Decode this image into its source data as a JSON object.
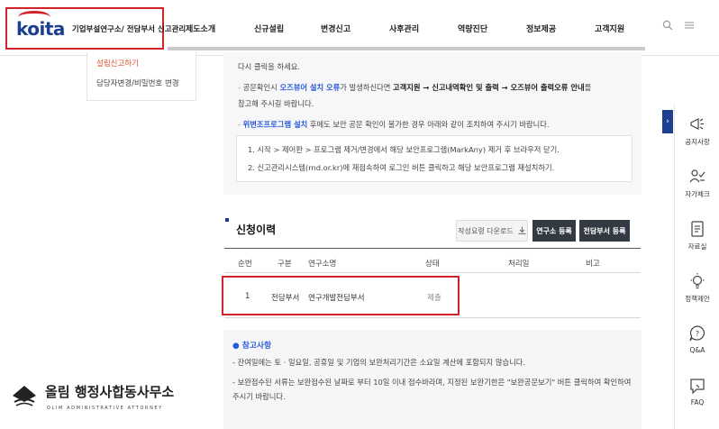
{
  "header": {
    "logo_text": "koita",
    "brand_title": "기업부설연구소/ 전담부서 신고관리",
    "nav": [
      "제도소개",
      "신규설립",
      "변경신고",
      "사후관리",
      "역량진단",
      "정보제공",
      "고객지원"
    ],
    "search_icon": "search-icon",
    "menu_icon": "hamburger-menu-icon"
  },
  "submenu": {
    "items": [
      "설립신고하기",
      "담당자변경/비밀번호 변경"
    ],
    "active_color": "#e0502e"
  },
  "notice": {
    "line1": "다시 클릭을 하세요.",
    "line2_a": "공문확인시 ",
    "line2_b": "오즈뷰어 설치 오류",
    "line2_c": "가 발생하신다면 ",
    "line2_d": "고객지원 → 신고내역확인 및 출력 → 오즈뷰어 출력오류 안내",
    "line2_e": "를",
    "line3": "참고해 주시길 바랍니다.",
    "line4_a": "위변조프로그램 설치",
    "line4_b": " 후에도 보안 공문 확인이 불가한 경우 아래와 같이 조치하여 주시기 바랍니다.",
    "steps": [
      "1.  시작 > 제어판 > 프로그램 제거/변경에서 해당 보안프로그램(MarkAny) 제거 후 브라우저 닫기.",
      "2.  신고관리시스템(rnd.or.kr)에 재접속하여 로그인 버튼 클릭하고 해당 보안프로그램 재설치하기."
    ]
  },
  "history": {
    "title": "신청이력",
    "buttons": {
      "download": "작성요령 다운로드",
      "lab_register": "연구소 등록",
      "dept_register": "전담부서 등록"
    },
    "columns": [
      "순번",
      "구분",
      "연구소명",
      "상태",
      "처리일",
      "비고"
    ],
    "rows": [
      {
        "no": "1",
        "type": "전담부서",
        "name": "연구개발전담부서",
        "status": "제출",
        "date": "",
        "note": ""
      }
    ]
  },
  "reference": {
    "title": "● 참고사항",
    "lines": [
      "- 잔여일에는 토 · 일요일, 공휴일 및 기업의 보완처리기간은 소요일 계산에 포함되지 않습니다.",
      "- 보완접수된 서류는 보완접수된 날짜로 부터 10일 이내 접수바라며, 지정된 보완기한은 \"보완공문보기\" 버튼 클릭하여 확인하여",
      "  주시기 바랍니다."
    ]
  },
  "quick_menu": [
    {
      "label": "공지사항",
      "icon": "megaphone-icon"
    },
    {
      "label": "자가체크",
      "icon": "people-check-icon"
    },
    {
      "label": "자료실",
      "icon": "document-icon"
    },
    {
      "label": "정책제안",
      "icon": "lightbulb-icon"
    },
    {
      "label": "Q&A",
      "icon": "chat-question-icon"
    },
    {
      "label": "FAQ",
      "icon": "faq-icon"
    }
  ],
  "watermark": {
    "title": "올림 행정사합동사무소",
    "subtitle": "OLIM ADMINISTRATIVE ATTORNEY"
  },
  "colors": {
    "highlight_box": "#d1232a",
    "brand_blue": "#1d3f8f",
    "link_blue": "#2a5bd7"
  }
}
